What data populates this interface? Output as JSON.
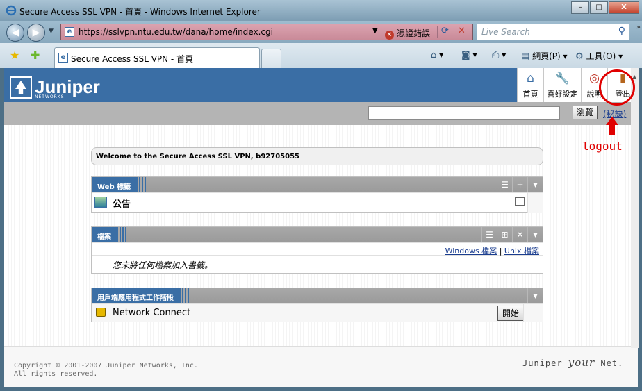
{
  "window": {
    "title": "Secure Access SSL VPN - 首頁 - Windows Internet Explorer",
    "minimize": "–",
    "maximize": "□",
    "close": "X"
  },
  "address": {
    "url": "https://sslvpn.ntu.edu.tw/dana/home/index.cgi",
    "cert_error": "憑證錯誤",
    "search_placeholder": "Live Search"
  },
  "tab": {
    "label": "Secure Access SSL VPN - 首頁"
  },
  "command_bar": {
    "page": "網頁(P)",
    "tools": "工具(O)"
  },
  "toolbar": {
    "home": "首頁",
    "prefs": "喜好設定",
    "help": "說明",
    "logout": "登出"
  },
  "searchbar": {
    "browse": "瀏覽",
    "tip": "(秘訣)"
  },
  "annotation": {
    "label": "logout"
  },
  "welcome": "Welcome to the Secure Access SSL VPN, b92705055",
  "panels": {
    "web": {
      "title": "Web 標籤",
      "items": [
        {
          "label": "公告"
        }
      ]
    },
    "files": {
      "title": "檔案",
      "link_windows": "Windows 檔案",
      "sep": "|",
      "link_unix": "Unix 檔案",
      "empty": "您未將任何檔案加入書籤。"
    },
    "client": {
      "title": "用戶端應用程式工作階段",
      "item": "Network Connect",
      "start": "開始"
    }
  },
  "footer": {
    "copyright": "Copyright © 2001-2007 Juniper Networks, Inc.",
    "rights": "All rights reserved.",
    "brand_a": "Juniper ",
    "brand_b": "your",
    "brand_c": " Net."
  },
  "logo": {
    "name": "Juniper",
    "sub": "NETWORKS"
  }
}
